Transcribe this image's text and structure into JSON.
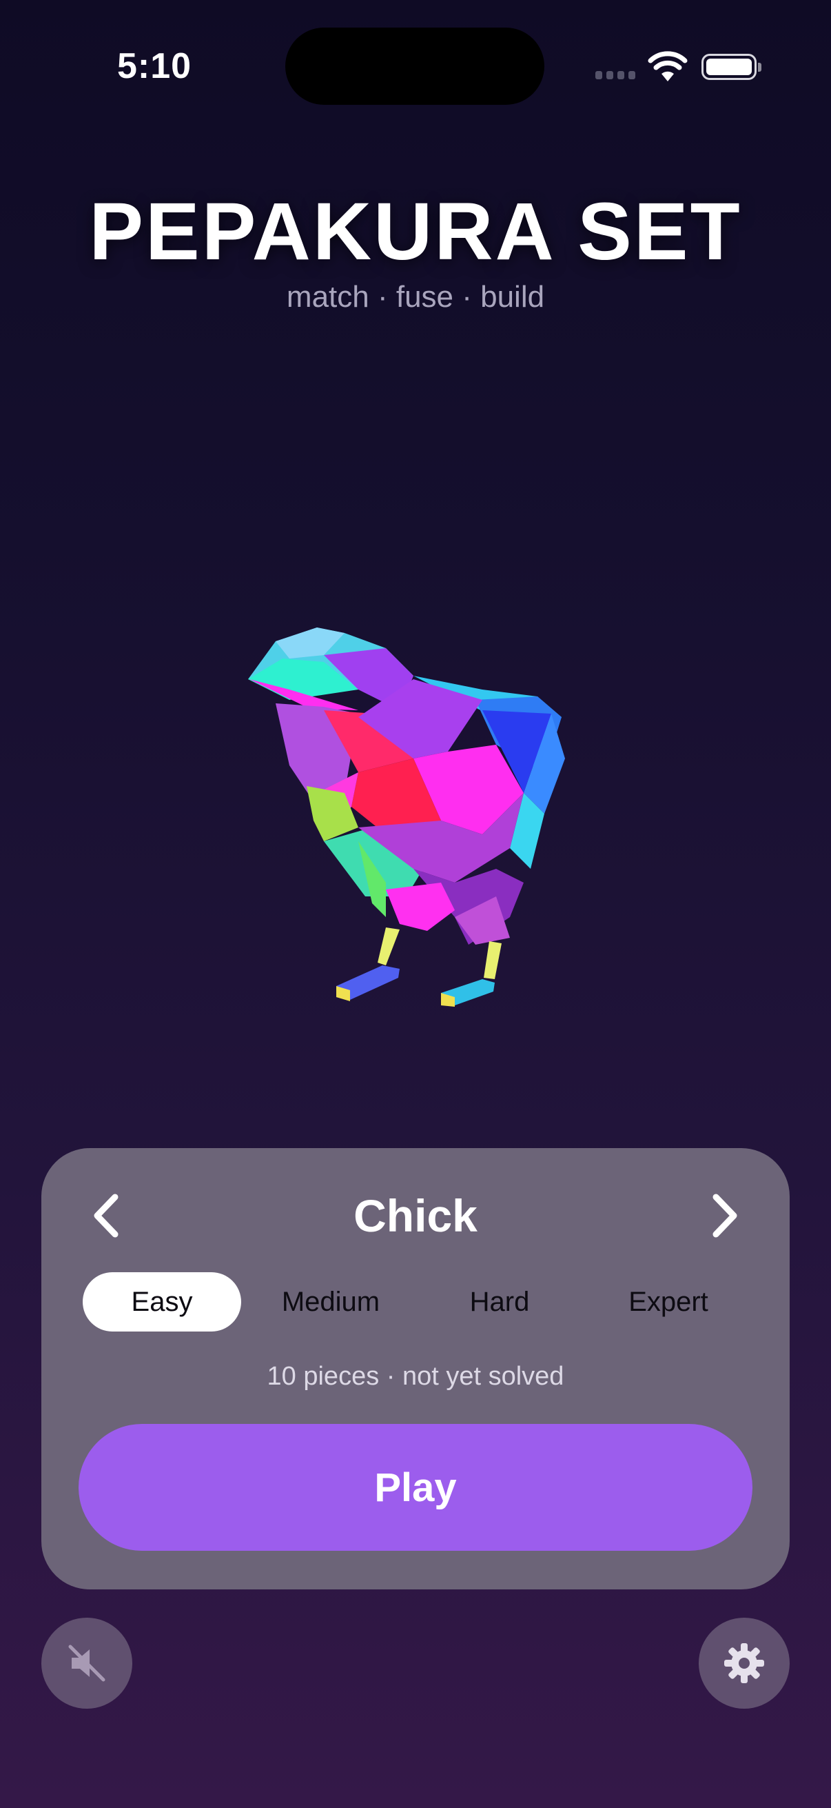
{
  "status_bar": {
    "time": "5:10"
  },
  "header": {
    "title": "PEPAKURA SET",
    "subtitle": "match · fuse · build"
  },
  "viewer": {
    "model_icon": "low-poly-chick"
  },
  "selector": {
    "model_name": "Chick",
    "prev_icon": "chevron-left-icon",
    "next_icon": "chevron-right-icon",
    "difficulties": [
      {
        "label": "Easy",
        "selected": true
      },
      {
        "label": "Medium",
        "selected": false
      },
      {
        "label": "Hard",
        "selected": false
      },
      {
        "label": "Expert",
        "selected": false
      }
    ],
    "info": "10 pieces · not yet solved",
    "play_label": "Play"
  },
  "footer": {
    "mute_icon": "speaker-muted-icon",
    "settings_icon": "gear-icon"
  },
  "colors": {
    "accent": "#9c5ded",
    "panel": "#6c6478",
    "background_top": "#0f0b25",
    "background_bottom": "#341848"
  }
}
